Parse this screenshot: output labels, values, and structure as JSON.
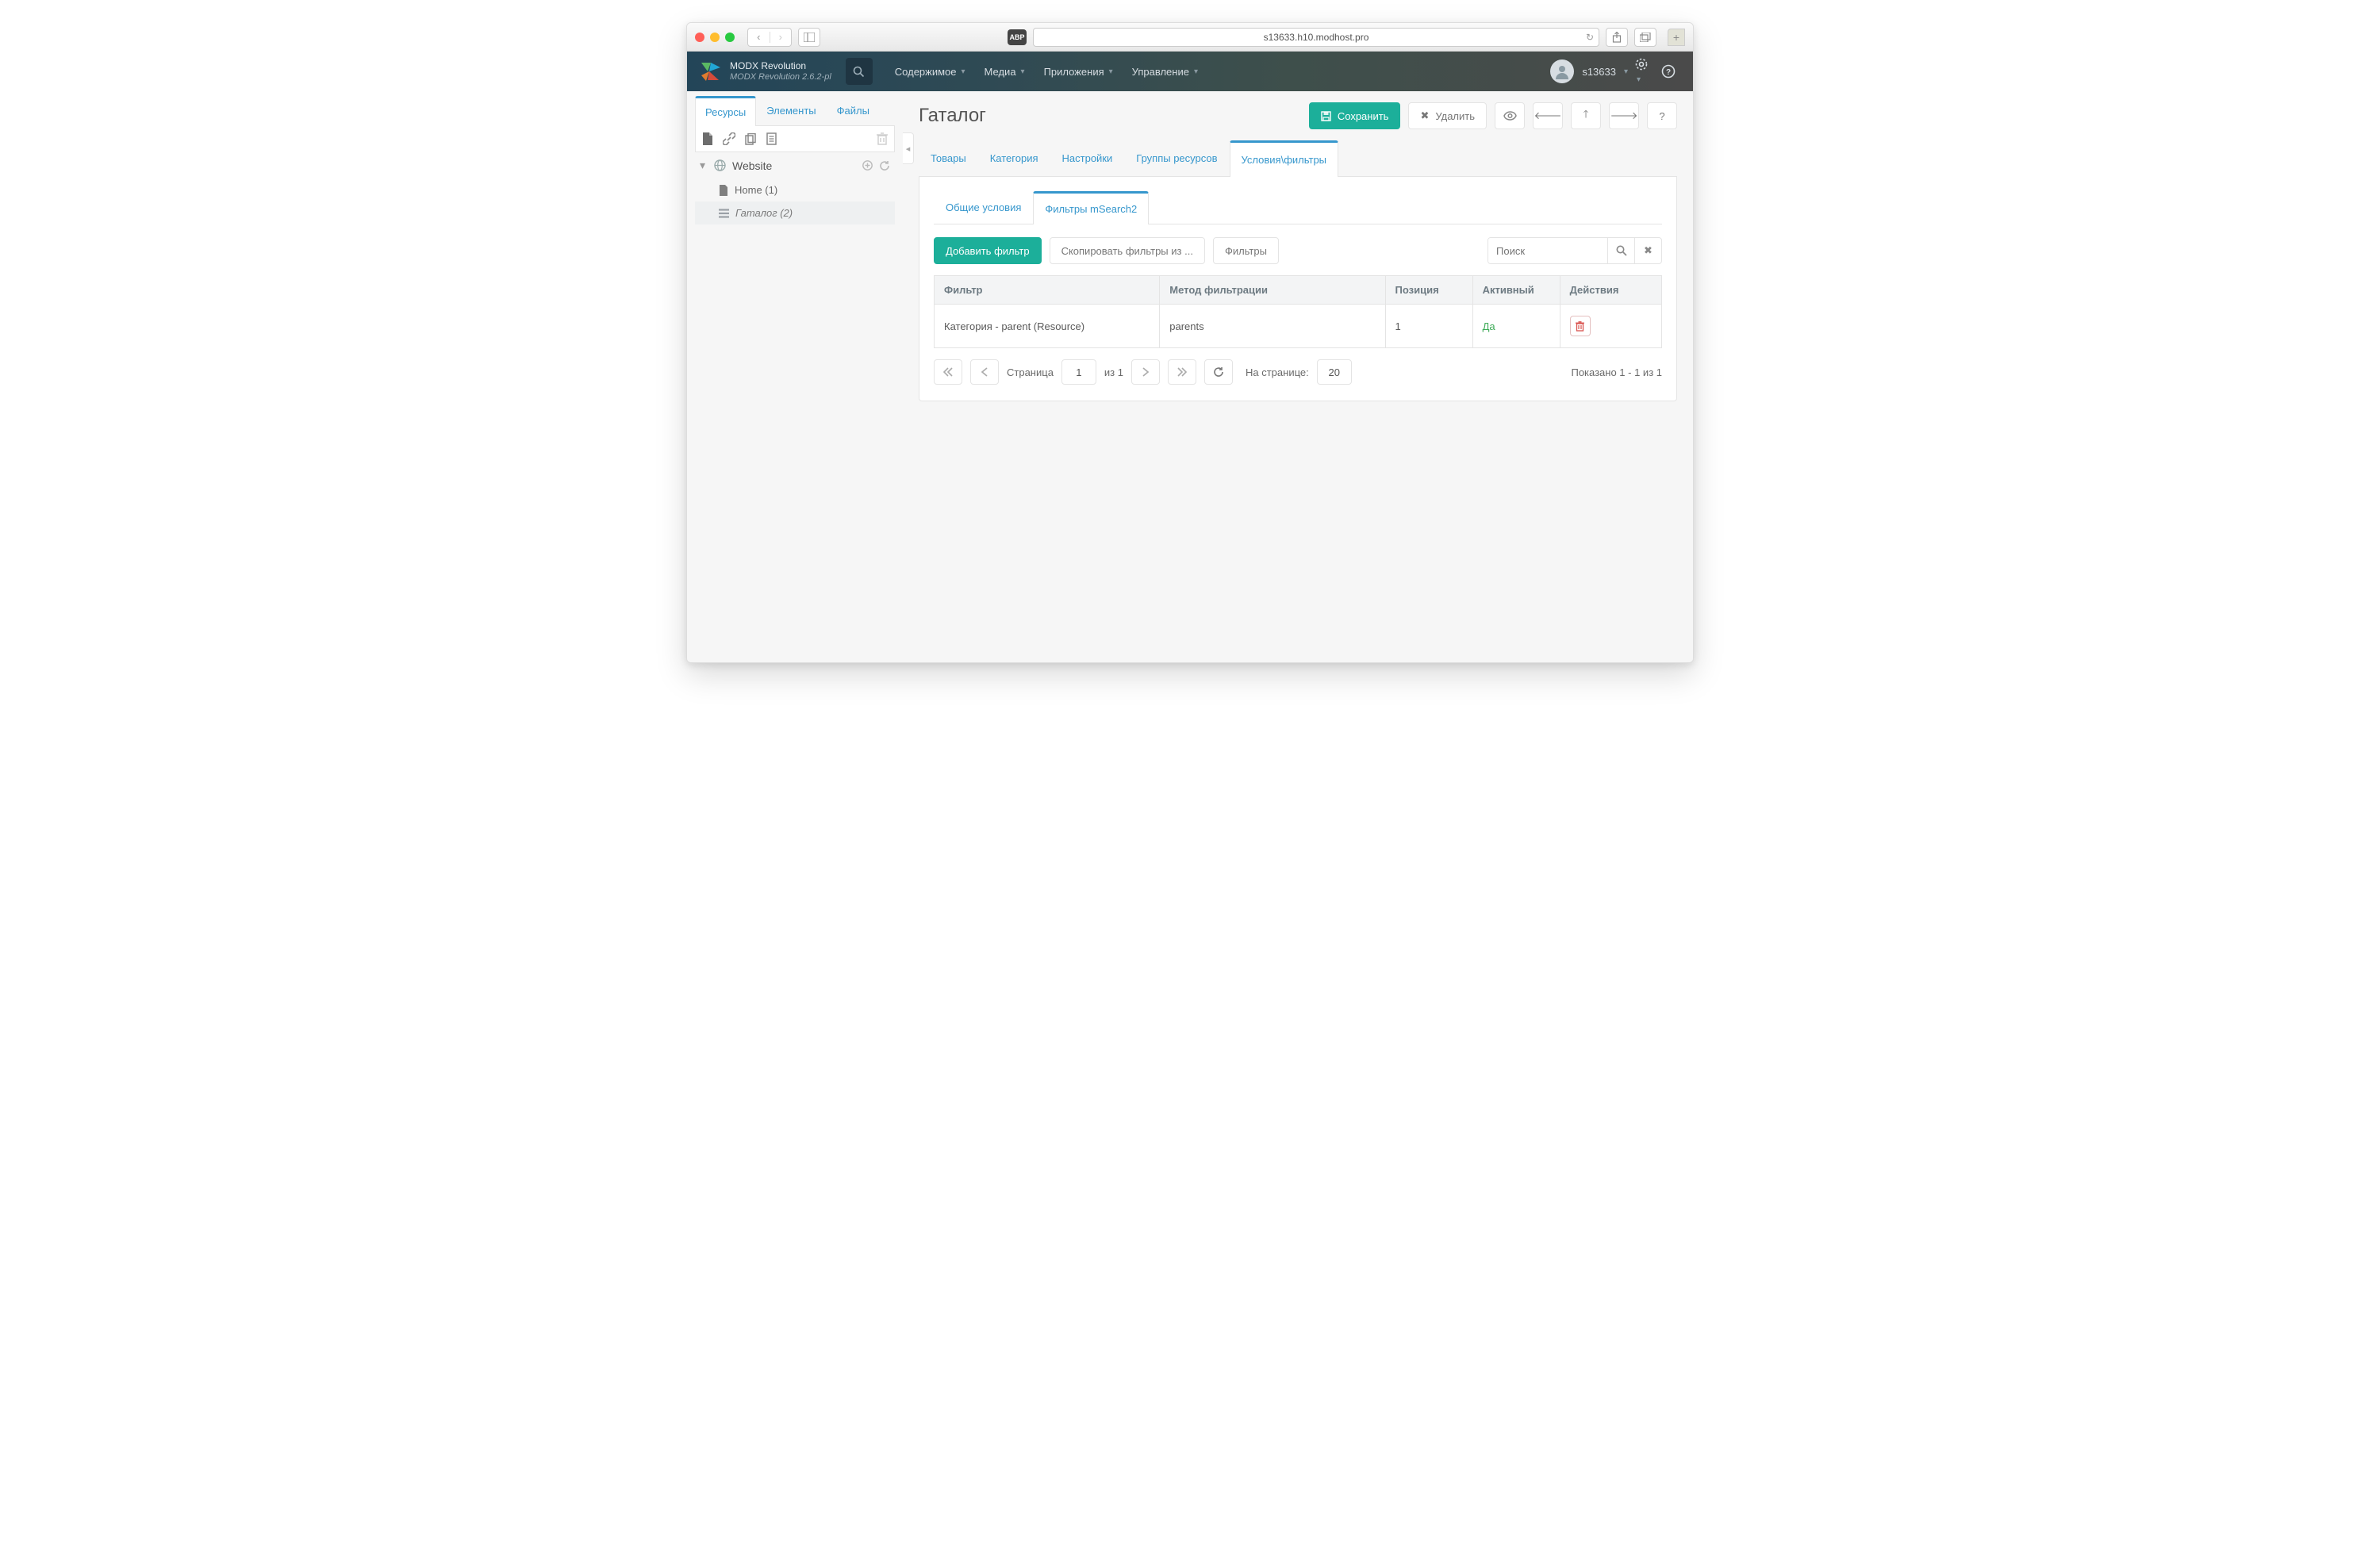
{
  "browser": {
    "url": "s13633.h10.modhost.pro"
  },
  "brand": {
    "line1": "MODX Revolution",
    "line2": "MODX Revolution 2.6.2-pl"
  },
  "topMenu": {
    "items": [
      "Содержимое",
      "Медиа",
      "Приложения",
      "Управление"
    ]
  },
  "user": {
    "name": "s13633"
  },
  "actions": {
    "title": "Гаталог",
    "save": "Сохранить",
    "delete": "Удалить"
  },
  "sidebar": {
    "tabs": [
      "Ресурсы",
      "Элементы",
      "Файлы"
    ],
    "activeTab": 0,
    "siteName": "Website",
    "tree": [
      {
        "label": "Home (1)",
        "icon": "file"
      },
      {
        "label": "Гаталог (2)",
        "icon": "list",
        "selected": true
      }
    ]
  },
  "mainTabs": {
    "items": [
      "Товары",
      "Категория",
      "Настройки",
      "Группы ресурсов",
      "Условия\\фильтры"
    ],
    "active": 4
  },
  "subTabs": {
    "items": [
      "Общие условия",
      "Фильтры mSearch2"
    ],
    "active": 1
  },
  "gridToolbar": {
    "add": "Добавить фильтр",
    "copy": "Скопировать фильтры из ...",
    "filters": "Фильтры",
    "searchPlaceholder": "Поиск"
  },
  "grid": {
    "headers": [
      "Фильтр",
      "Метод фильтрации",
      "Позиция",
      "Активный",
      "Действия"
    ],
    "rows": [
      {
        "filter": "Категория - parent (Resource)",
        "method": "parents",
        "position": "1",
        "active": "Да"
      }
    ]
  },
  "pager": {
    "pageLabel": "Страница",
    "page": "1",
    "ofLabel": "из 1",
    "perPageLabel": "На странице:",
    "perPage": "20",
    "shown": "Показано 1 - 1 из 1"
  }
}
